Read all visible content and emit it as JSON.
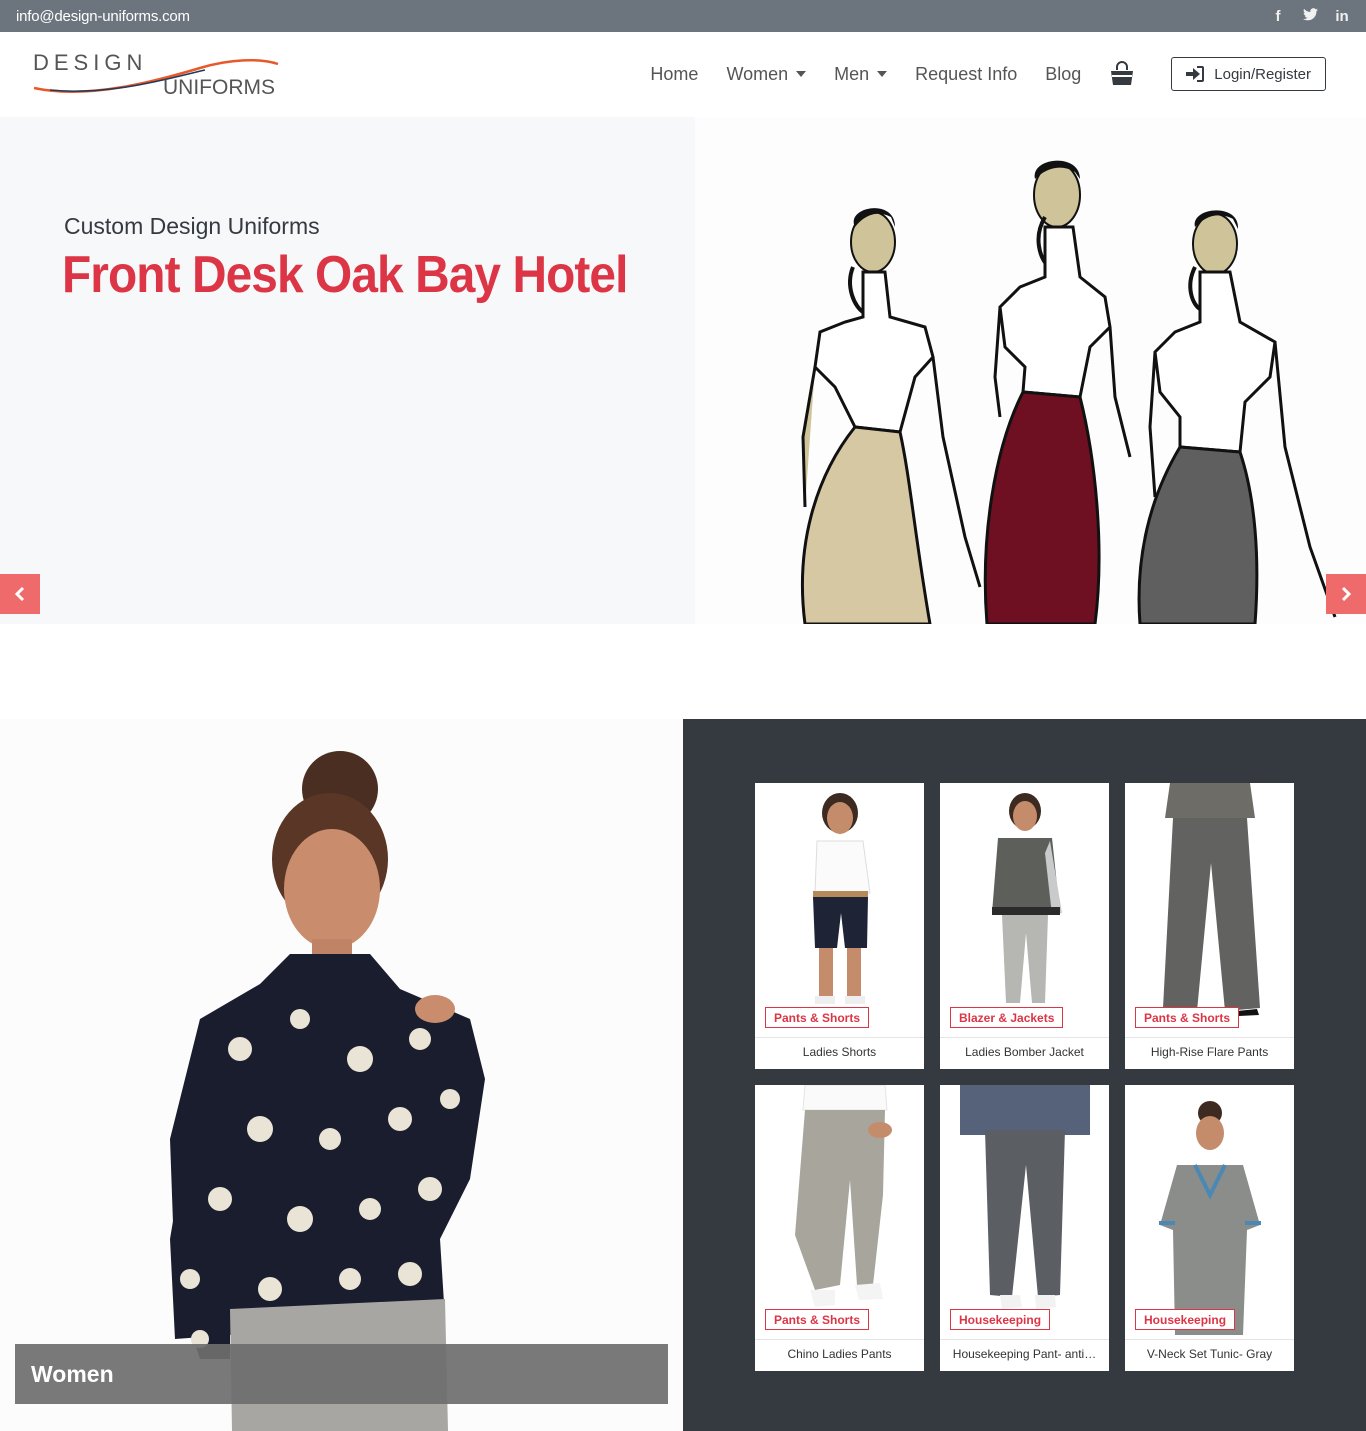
{
  "topbar": {
    "email": "info@design-uniforms.com",
    "social": [
      {
        "icon": "facebook-icon",
        "glyph": "f"
      },
      {
        "icon": "twitter-icon",
        "glyph": "t"
      },
      {
        "icon": "linkedin-icon",
        "glyph": "in"
      }
    ]
  },
  "logo": {
    "line1": "DESIGN",
    "line2": "UNIFORMS"
  },
  "nav": {
    "home": "Home",
    "women": "Women",
    "men": "Men",
    "request_info": "Request Info",
    "blog": "Blog",
    "login": "Login/Register"
  },
  "hero": {
    "subtitle": "Custom Design Uniforms",
    "title": "Front Desk Oak Bay Hotel"
  },
  "women_panel": {
    "label": "Women"
  },
  "products": [
    {
      "category": "Pants & Shorts",
      "name": "Ladies Shorts"
    },
    {
      "category": "Blazer & Jackets",
      "name": "Ladies Bomber Jacket"
    },
    {
      "category": "Pants & Shorts",
      "name": "High-Rise Flare Pants"
    },
    {
      "category": "Pants & Shorts",
      "name": "Chino Ladies Pants"
    },
    {
      "category": "Housekeeping",
      "name": "Housekeeping Pant- anti…"
    },
    {
      "category": "Housekeeping",
      "name": "V-Neck Set Tunic- Gray"
    }
  ],
  "colors": {
    "accent": "#dc3545",
    "topbar": "#6c757d",
    "dark_panel": "#343a40",
    "arrow": "#ef6b6b"
  }
}
